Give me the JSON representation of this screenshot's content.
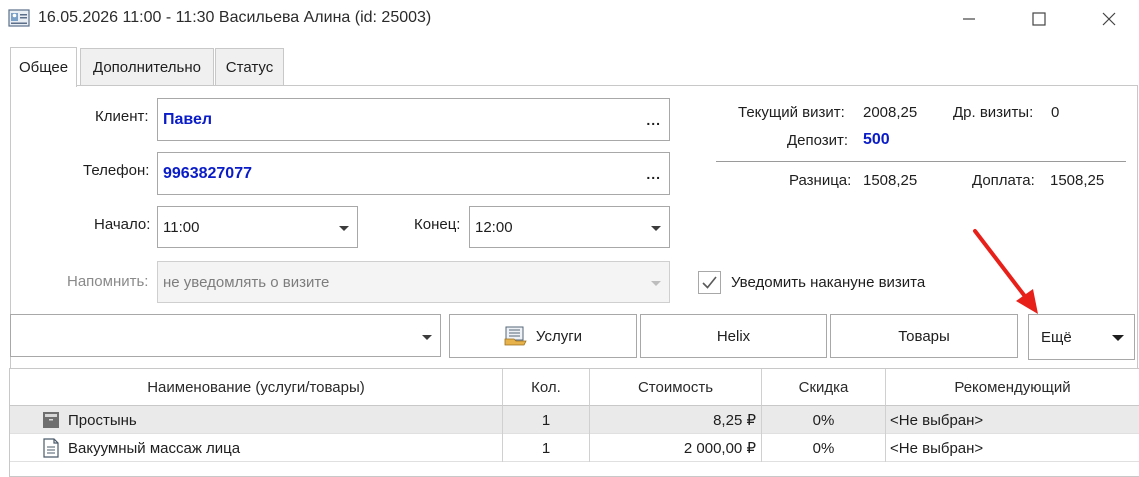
{
  "window": {
    "title": "16.05.2026 11:00 - 11:30 Васильева Алина (id: 25003)",
    "icons": {
      "app": "visit-card-icon",
      "minimize": "minimize-icon",
      "maximize": "maximize-icon",
      "close": "close-icon"
    }
  },
  "tabs": [
    {
      "label": "Общее",
      "active": true
    },
    {
      "label": "Дополнительно",
      "active": false
    },
    {
      "label": "Статус",
      "active": false
    }
  ],
  "form": {
    "client_label": "Клиент:",
    "client_value": "Павел",
    "phone_label": "Телефон:",
    "phone_value": "9963827077",
    "ellipsis": "...",
    "start_label": "Начало:",
    "start_value": "11:00",
    "end_label": "Конец:",
    "end_value": "12:00",
    "remind_label": "Напомнить:",
    "remind_value": "не уведомлять о визите",
    "notify_label": "Уведомить накануне визита",
    "notify_checked": true
  },
  "summary": {
    "current_visit_label": "Текущий визит:",
    "current_visit_value": "2008,25",
    "other_visits_label": "Др. визиты:",
    "other_visits_value": "0",
    "deposit_label": "Депозит:",
    "deposit_value": "500",
    "diff_label": "Разница:",
    "diff_value": "1508,25",
    "surcharge_label": "Доплата:",
    "surcharge_value": "1508,25"
  },
  "toolbar": {
    "select_value": "",
    "services_label": "Услуги",
    "helix_label": "Helix",
    "goods_label": "Товары",
    "more_label": "Ещё"
  },
  "table": {
    "headers": [
      "Наименование (услуги/товары)",
      "Кол.",
      "Стоимость",
      "Скидка",
      "Рекомендующий"
    ],
    "rows": [
      {
        "icon": "product-icon",
        "name": "Простынь",
        "qty": "1",
        "cost": "8,25 ₽",
        "discount": "0%",
        "recommender": "<Не выбран>",
        "selected": true
      },
      {
        "icon": "service-document-icon",
        "name": "Вакуумный массаж лица",
        "qty": "1",
        "cost": "2 000,00 ₽",
        "discount": "0%",
        "recommender": "<Не выбран>",
        "selected": false
      }
    ]
  },
  "colors": {
    "accent_blue": "#0a1cc8",
    "arrow_red": "#e8201a"
  }
}
